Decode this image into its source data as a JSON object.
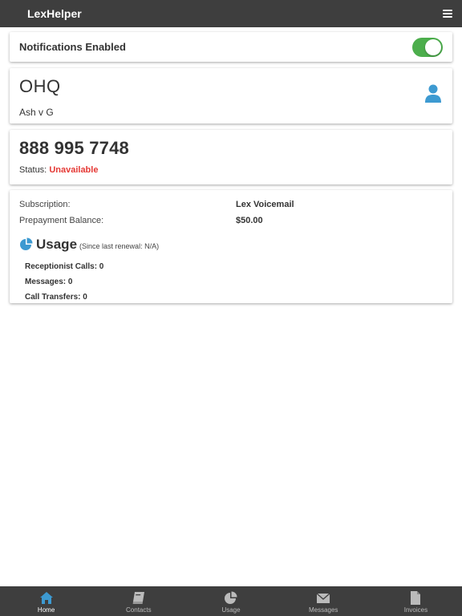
{
  "header": {
    "title": "LexHelper",
    "menu_icon": "hamburger-icon"
  },
  "notifications": {
    "label": "Notifications Enabled",
    "enabled": true,
    "toggle_color": "#4cae4c"
  },
  "account": {
    "code": "OHQ",
    "name": "Ash v G",
    "icon": "user-icon",
    "icon_color": "#3d9ad1"
  },
  "phone": {
    "number": "888 995 7748",
    "status_label": "Status:",
    "status_value": "Unavailable",
    "status_color": "#e53935"
  },
  "subscription": {
    "rows": [
      {
        "label": "Subscription:",
        "value": "Lex Voicemail"
      },
      {
        "label": "Prepayment Balance:",
        "value": "$50.00"
      }
    ]
  },
  "usage": {
    "icon": "pie-chart-icon",
    "title": "Usage",
    "note": "(Since last renewal: N/A)",
    "items": [
      "Receptionist Calls: 0",
      "Messages: 0",
      "Call Transfers: 0"
    ]
  },
  "tabs": [
    {
      "label": "Home",
      "icon": "home-icon",
      "active": true
    },
    {
      "label": "Contacts",
      "icon": "book-icon",
      "active": false
    },
    {
      "label": "Usage",
      "icon": "pie-chart-icon",
      "active": false
    },
    {
      "label": "Messages",
      "icon": "envelope-icon",
      "active": false
    },
    {
      "label": "Invoices",
      "icon": "file-icon",
      "active": false
    }
  ],
  "colors": {
    "bar_bg": "#3e3e3e",
    "accent": "#3d9ad1"
  }
}
